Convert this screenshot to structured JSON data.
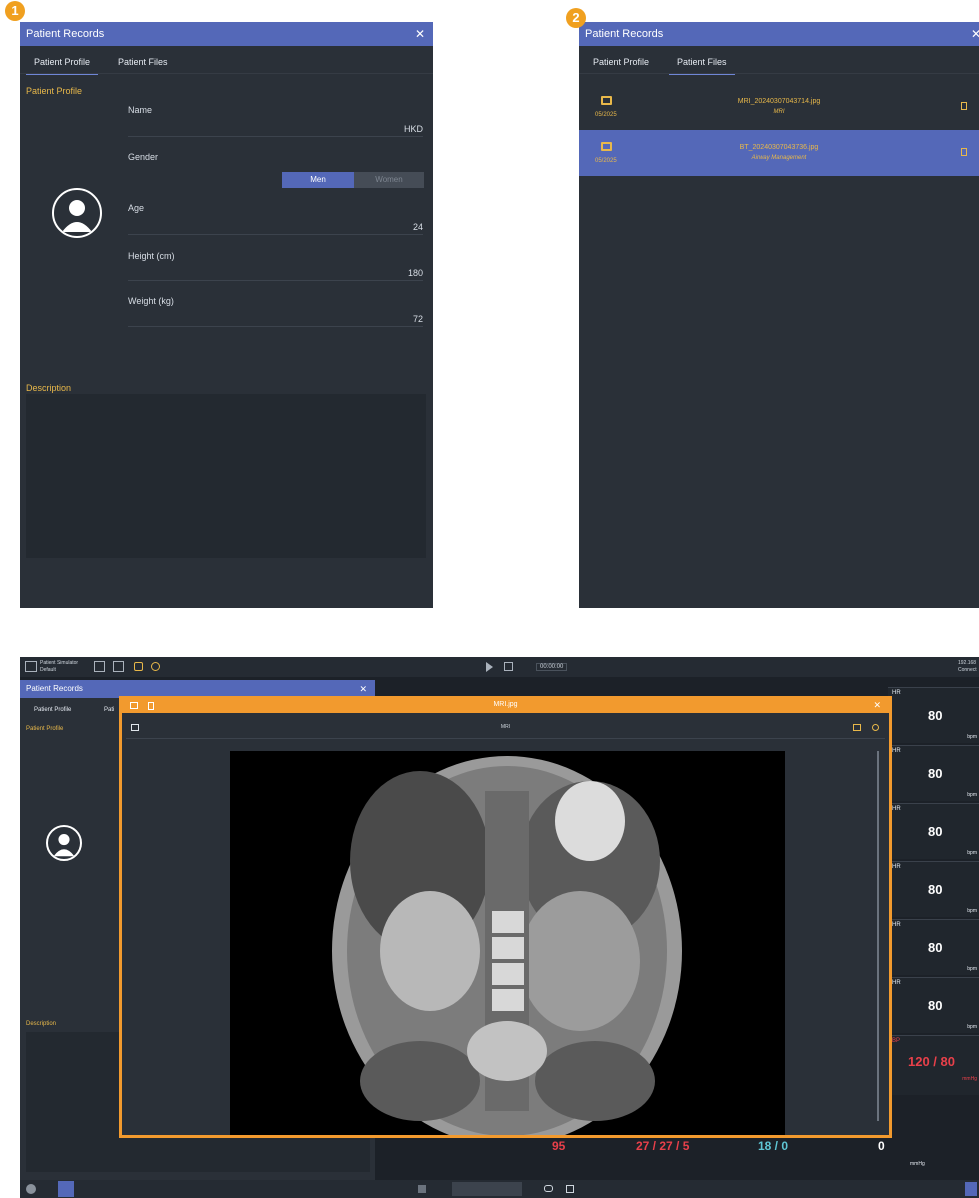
{
  "markers": [
    "1",
    "2"
  ],
  "panel1": {
    "title": "Patient Records",
    "tabs": [
      "Patient Profile",
      "Patient Files"
    ],
    "section_title": "Patient Profile",
    "fields": {
      "name_label": "Name",
      "name_value": "HKD",
      "gender_label": "Gender",
      "gender_options": [
        "Men",
        "Women"
      ],
      "gender_selected": "Men",
      "age_label": "Age",
      "age_value": "24",
      "height_label": "Height (cm)",
      "height_value": "180",
      "weight_label": "Weight (kg)",
      "weight_value": "72"
    },
    "description_label": "Description"
  },
  "panel2": {
    "title": "Patient Records",
    "tabs": [
      "Patient Profile",
      "Patient Files"
    ],
    "files": [
      {
        "name": "MRI_20240307043714.jpg",
        "sub": "MRI",
        "date": "05/2025",
        "selected": false
      },
      {
        "name": "BT_20240307043736.jpg",
        "sub": "Airway Management",
        "date": "05/2025",
        "selected": true
      }
    ]
  },
  "monitor": {
    "topbar": {
      "device_name": "Patient Simulator",
      "device_sub": "Default",
      "time": "00:00:00",
      "ip": "192.168",
      "status": "Connect"
    },
    "records_title": "Patient Records",
    "records_tabs": [
      "Patient Profile",
      "Pati"
    ],
    "section_title": "Patient Profile",
    "description_label": "Description",
    "viewer": {
      "title": "MRI.jpg",
      "inner_label": "MRI"
    },
    "vitals": [
      {
        "label": "HR",
        "value": "80",
        "unit": "bpm"
      },
      {
        "label": "HR",
        "value": "80",
        "unit": "bpm"
      },
      {
        "label": "HR",
        "value": "80",
        "unit": "bpm"
      },
      {
        "label": "HR",
        "value": "80",
        "unit": "bpm"
      },
      {
        "label": "HR",
        "value": "80",
        "unit": "bpm"
      },
      {
        "label": "HR",
        "value": "80",
        "unit": "bpm"
      }
    ],
    "bp": {
      "label": "BP",
      "value": "120 / 80",
      "unit": "mmHg"
    },
    "bottom_values": {
      "v1": "95",
      "v2": "27 / 27 / 5",
      "v3": "18 / 0",
      "v4": "0",
      "unit": "mmHg"
    },
    "colors": {
      "accent": "#5468b8",
      "viewer": "#f29a2e",
      "alarm": "#e8404a",
      "gold": "#e8b84a"
    }
  }
}
